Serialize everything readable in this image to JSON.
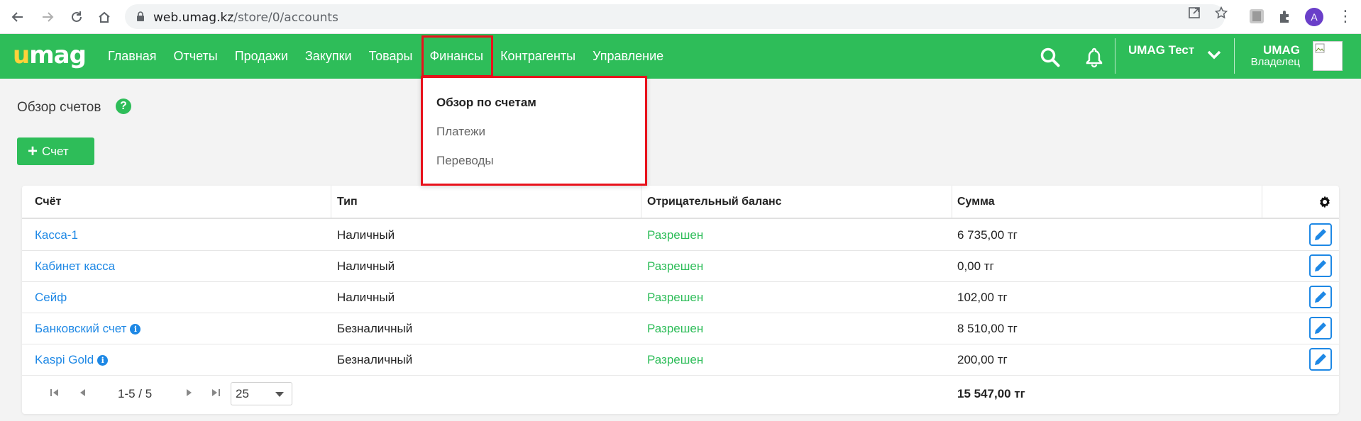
{
  "browser": {
    "url_host": "web.umag.kz",
    "url_path": "/store/0/accounts",
    "profile_initial": "A"
  },
  "app": {
    "logo_first": "u",
    "logo_rest": "mag",
    "nav": [
      "Главная",
      "Отчеты",
      "Продажи",
      "Закупки",
      "Товары",
      "Финансы",
      "Контрагенты",
      "Управление"
    ],
    "active_nav": "Финансы",
    "store_name": "UMAG Тест",
    "user_name": "UMAG",
    "user_role": "Владелец"
  },
  "dropdown": {
    "items": [
      "Обзор по счетам",
      "Платежи",
      "Переводы"
    ],
    "active": "Обзор по счетам"
  },
  "page": {
    "title": "Обзор счетов",
    "help_glyph": "?",
    "add_button_label": "Счет",
    "add_button_icon": "+"
  },
  "table": {
    "headers": [
      "Счёт",
      "Тип",
      "Отрицательный баланс",
      "Сумма"
    ],
    "rows": [
      {
        "account": "Касса-1",
        "type": "Наличный",
        "negative": "Разрешен",
        "sum": "6 735,00 тг",
        "info": false
      },
      {
        "account": "Кабинет касса",
        "type": "Наличный",
        "negative": "Разрешен",
        "sum": "0,00 тг",
        "info": false
      },
      {
        "account": "Сейф",
        "type": "Наличный",
        "negative": "Разрешен",
        "sum": "102,00 тг",
        "info": false
      },
      {
        "account": "Банковский счет",
        "type": "Безналичный",
        "negative": "Разрешен",
        "sum": "8 510,00 тг",
        "info": true
      },
      {
        "account": "Kaspi Gold",
        "type": "Безналичный",
        "negative": "Разрешен",
        "sum": "200,00 тг",
        "info": true
      }
    ],
    "info_glyph": "i",
    "pagination_text": "1-5 / 5",
    "page_size": "25",
    "total": "15 547,00 тг"
  },
  "colors": {
    "brand_green": "#2ebd59",
    "logo_yellow": "#ffd23a",
    "link_blue": "#1e88e5",
    "highlight_red": "#e8121c"
  }
}
